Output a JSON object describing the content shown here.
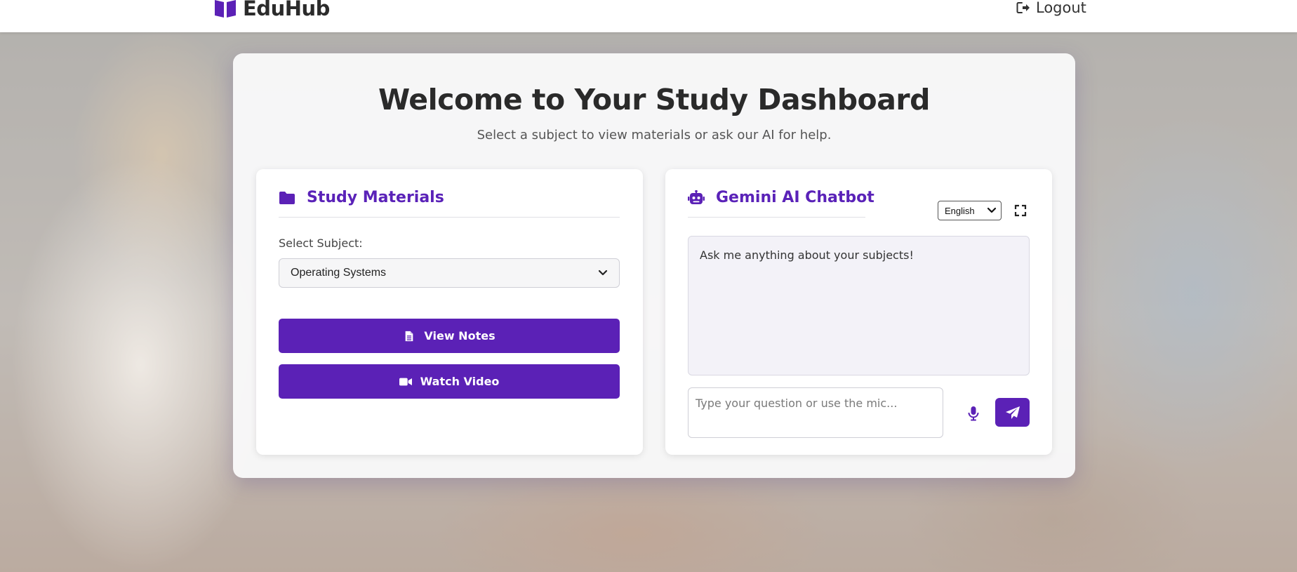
{
  "header": {
    "brand_name": "EduHub",
    "brand_icon": "book-icon",
    "logout_label": "Logout",
    "logout_icon": "sign-out-icon"
  },
  "main": {
    "title": "Welcome to Your Study Dashboard",
    "subtitle": "Select a subject to view materials or ask our AI for help."
  },
  "study_materials": {
    "title": "Study Materials",
    "icon": "folder-icon",
    "subject_label": "Select Subject:",
    "selected_subject": "Operating Systems",
    "view_notes_label": "View Notes",
    "view_notes_icon": "file-icon",
    "watch_video_label": "Watch Video",
    "watch_video_icon": "video-camera-icon"
  },
  "chatbot": {
    "title": "Gemini AI Chatbot",
    "icon": "robot-icon",
    "language": "English",
    "fullscreen_icon": "expand-icon",
    "initial_message": "Ask me anything about your subjects!",
    "input_placeholder": "Type your question or use the mic...",
    "mic_icon": "microphone-icon",
    "send_icon": "paper-plane-icon"
  },
  "colors": {
    "accent": "#5b21b6",
    "heading_accent": "#5a22b8",
    "text_dark": "#2a2a2a"
  }
}
